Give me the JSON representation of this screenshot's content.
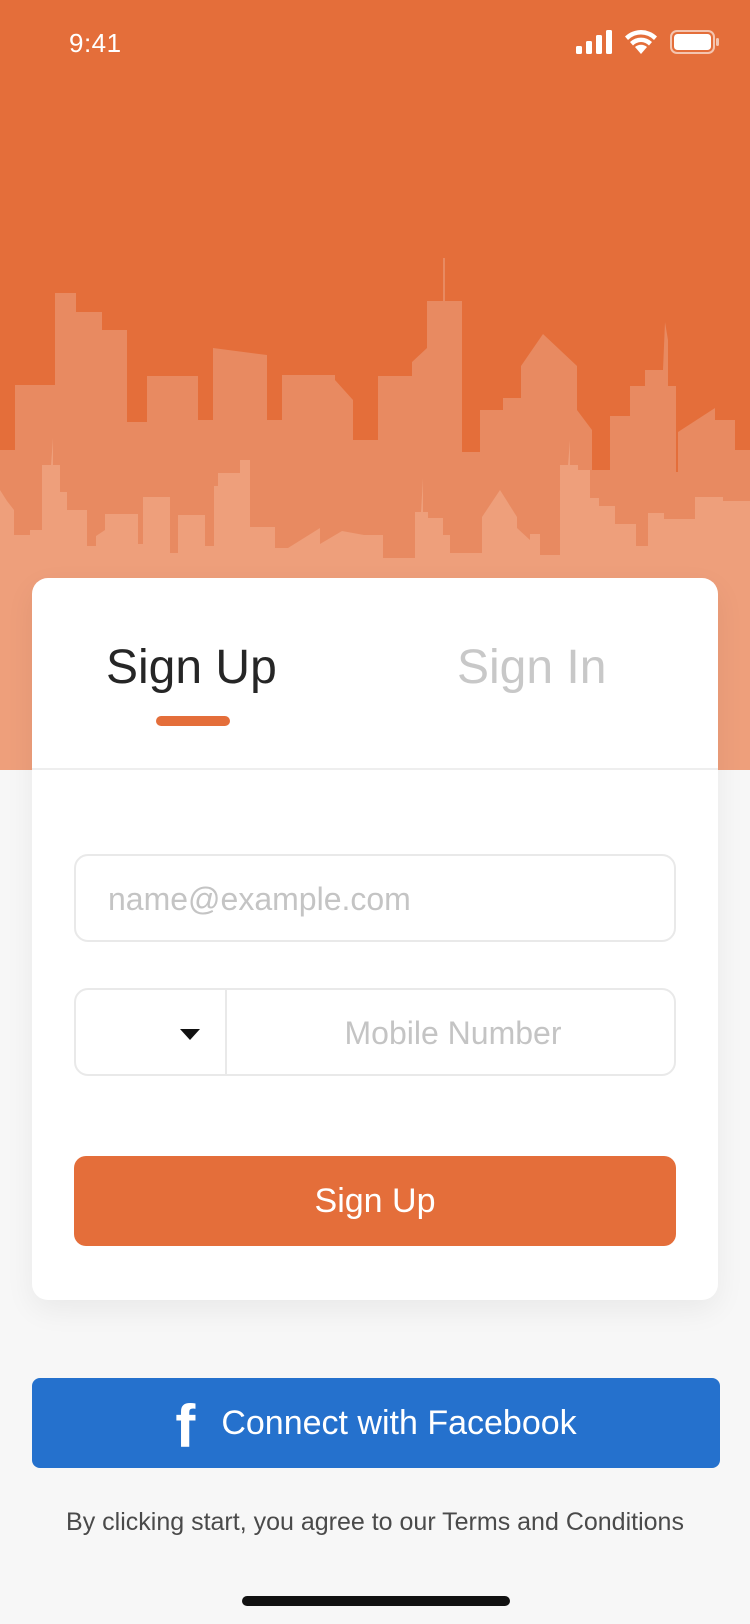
{
  "status_bar": {
    "time": "9:41",
    "icons": [
      "cellular-signal-icon",
      "wifi-icon",
      "battery-icon"
    ]
  },
  "colors": {
    "accent": "#e46e3a",
    "facebook": "#2571cd",
    "background": "#f7f7f7",
    "tab_inactive": "#c8c8c8"
  },
  "tabs": [
    {
      "label": "Sign Up",
      "active": true
    },
    {
      "label": "Sign In",
      "active": false
    }
  ],
  "form": {
    "email_placeholder": "name@example.com",
    "email_value": "",
    "country_code_value": "",
    "phone_placeholder": "Mobile Number",
    "phone_value": "",
    "submit_label": "Sign Up"
  },
  "facebook": {
    "icon": "facebook-f-icon",
    "glyph": "f",
    "label": "Connect with Facebook"
  },
  "terms_text": "By clicking start, you agree to our Terms and Conditions"
}
